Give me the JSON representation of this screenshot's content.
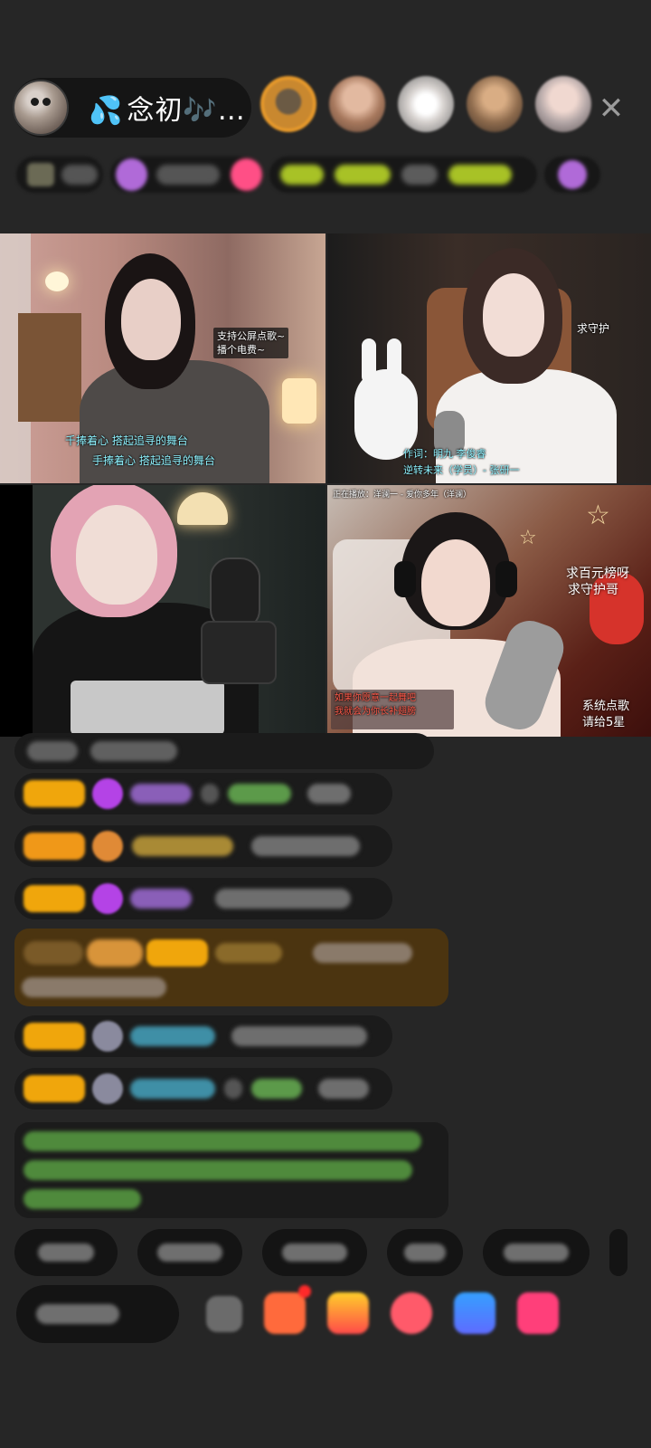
{
  "header": {
    "host_name": "念初🎶…",
    "host_drop_icon": "💦",
    "close_icon": "close-icon"
  },
  "viewers": [
    {
      "color": "#c9882f"
    },
    {
      "color": "#a7785d"
    },
    {
      "color": "#d7d2cf"
    },
    {
      "color": "#8e6b4d"
    },
    {
      "color": "#b3a6a6"
    }
  ],
  "tiles": {
    "tile1": {
      "caption_top_line1": "支持公屏点歌~",
      "caption_top_line2": "播个电费~",
      "lyric_line1": "千捧着心  搭起追寻的舞台",
      "lyric_line2": "手捧着心  搭起追寻的舞台"
    },
    "tile2": {
      "side_label": "求守护",
      "song_line1": "作词：明九  李俊睿",
      "song_line2": "逆转未来（学员）- 张研一"
    },
    "tile3": {},
    "tile4": {
      "now_playing": "正在播放：洋澜一 - 爱你多年（洋澜）",
      "side_line1": "求百元榜呀",
      "side_line2": "求守护哥",
      "bottom_line1": "如果你愿意一起舞吧",
      "bottom_line2": "我就会为你长补翅膀",
      "corner_line1": "系统点歌",
      "corner_line2": "请给5星"
    }
  },
  "colors": {
    "badge_yellow": "#f0a60c",
    "badge_orange": "#f09818",
    "gem_purple": "#b443e6",
    "name_purple": "#8a5fb8",
    "name_green": "#5c9a4a",
    "name_teal": "#3f8fa6",
    "text_gray": "#7a7a7a",
    "gold_box": "#4b3410",
    "green_text": "#5fa34a"
  }
}
